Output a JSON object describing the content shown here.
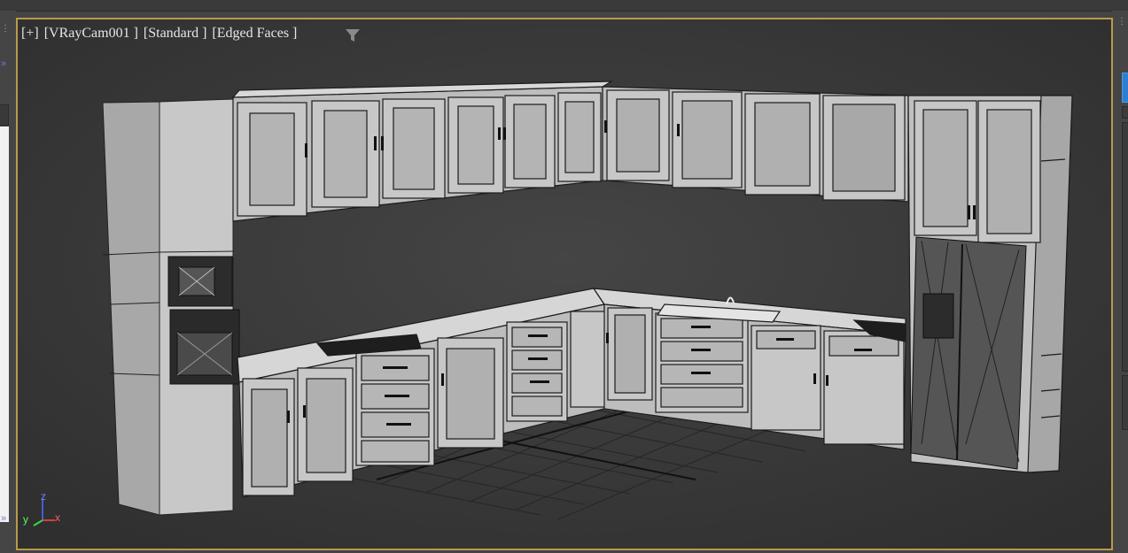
{
  "viewport": {
    "menu_plus": "[+]",
    "camera": "[VRayCam001 ]",
    "shading": "[Standard ]",
    "display_mode": "[Edged Faces ]",
    "filter_icon": "filter-funnel-icon"
  },
  "axis_gizmo": {
    "x": "x",
    "y": "y",
    "z": "z"
  },
  "colors": {
    "viewport_border": "#b99a4a",
    "viewport_bg": "#3a3a3a",
    "panel_bg": "#454545",
    "accent_blue": "#6a7fd6",
    "cabinet_fill": "#c4c4c4",
    "edge_lines": "#202020"
  },
  "side_controls": {
    "left_arrow_glyph": "»",
    "grip_glyph": "⋮"
  }
}
